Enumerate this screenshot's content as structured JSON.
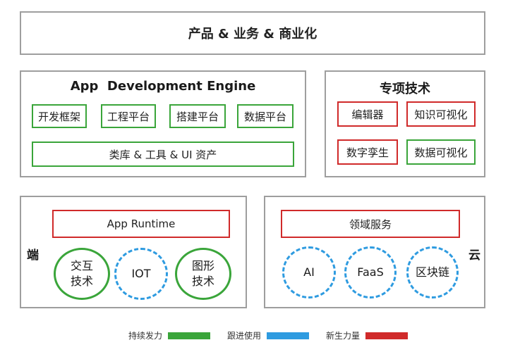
{
  "top": {
    "title": "产品 & 业务 & 商业化"
  },
  "engine": {
    "title": "App  Development Engine",
    "modules": [
      "开发框架",
      "工程平台",
      "搭建平台",
      "数据平台"
    ],
    "library": "类库 & 工具 & UI 资产"
  },
  "special": {
    "title": "专项技术",
    "items": [
      "编辑器",
      "知识可视化",
      "数字孪生",
      "数据可视化"
    ]
  },
  "client": {
    "side_label": "端",
    "runtime": "App Runtime",
    "circles": [
      {
        "label": "交互\n技术",
        "status": "green"
      },
      {
        "label": "IOT",
        "status": "blue"
      },
      {
        "label": "图形\n技术",
        "status": "green"
      }
    ]
  },
  "cloud": {
    "side_label": "云",
    "service": "领域服务",
    "circles": [
      {
        "label": "AI",
        "status": "blue"
      },
      {
        "label": "FaaS",
        "status": "blue"
      },
      {
        "label": "区块链",
        "status": "blue"
      }
    ]
  },
  "legend": [
    {
      "label": "持续发力",
      "color": "#3aa53a"
    },
    {
      "label": "跟进使用",
      "color": "#2e9be0"
    },
    {
      "label": "新生力量",
      "color": "#d02a2a"
    }
  ]
}
